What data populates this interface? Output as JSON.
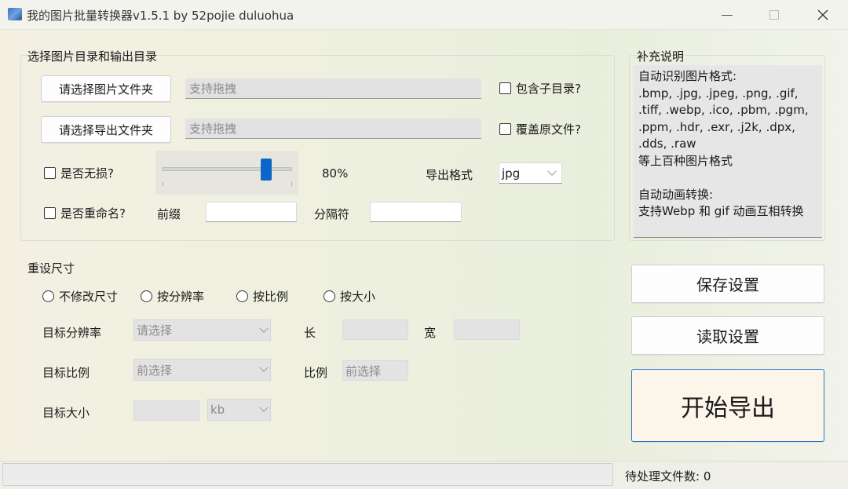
{
  "window": {
    "title": "我的图片批量转换器v1.5.1 by 52pojie duluohua",
    "icon": "app-picture-icon",
    "controls": [
      "minimize-icon",
      "maximize-icon",
      "close-icon"
    ]
  },
  "directory": {
    "group_title": "选择图片目录和输出目录",
    "select_image_button": "请选择图片文件夹",
    "select_output_button": "请选择导出文件夹",
    "image_dir_placeholder": "支持拖拽",
    "output_dir_placeholder": "支持拖拽",
    "include_subdirs_label": "包含子目录?",
    "overwrite_label": "覆盖原文件?",
    "lossless_label": "是否无损?",
    "quality_value": "80%",
    "quality_level": 0.8,
    "export_format_label": "导出格式",
    "export_format_value": "jpg",
    "rename_label": "是否重命名?",
    "prefix_label": "前缀",
    "separator_label": "分隔符"
  },
  "resize": {
    "group_title": "重设尺寸",
    "options": [
      "不修改尺寸",
      "按分辨率",
      "按比例",
      "按大小"
    ],
    "target_resolution_label": "目标分辨率",
    "resolution_placeholder": "请选择",
    "length_label": "长",
    "width_label": "宽",
    "target_ratio_label": "目标比例",
    "ratio_combo_placeholder": "前选择",
    "ratio_label": "比例",
    "ratio_input_placeholder": "前选择",
    "target_size_label": "目标大小",
    "size_unit": "kb"
  },
  "notes": {
    "group_title": "补充说明",
    "lines": [
      "自动识别图片格式:",
      ".bmp, .jpg, .jpeg, .png, .gif,",
      ".tiff, .webp, .ico, .pbm, .pgm,",
      ".ppm, .hdr, .exr, .j2k, .dpx,",
      ".dds, .raw",
      "等上百种图片格式",
      "",
      "自动动画转换:",
      "支持Webp 和 gif 动画互相转换"
    ]
  },
  "actions": {
    "save_button": "保存设置",
    "load_button": "读取设置",
    "start_button": "开始导出"
  },
  "status": {
    "pending_files": "待处理文件数: 0"
  }
}
